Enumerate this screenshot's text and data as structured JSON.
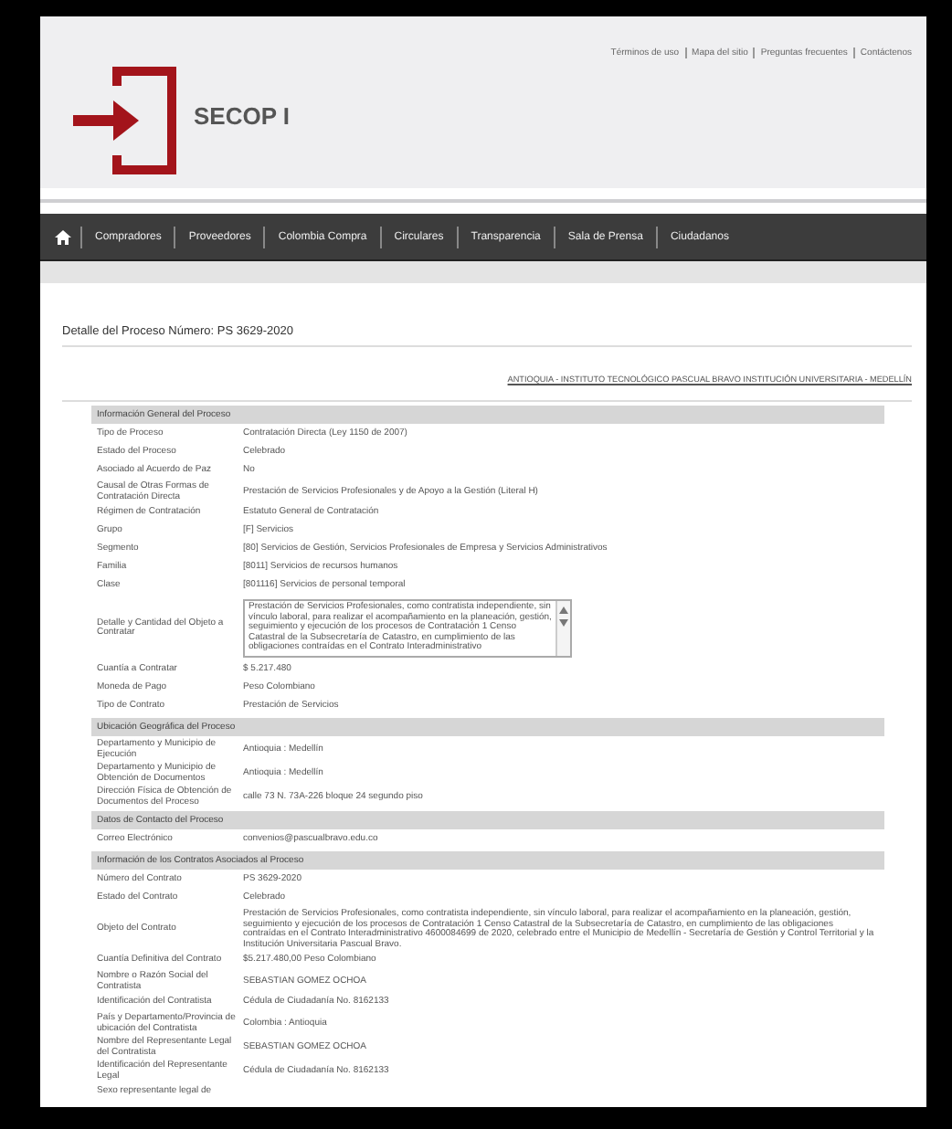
{
  "top_links": [
    "Términos de uso",
    "Mapa del sitio",
    "Preguntas frecuentes",
    "Contáctenos"
  ],
  "logo": {
    "text": "SECOP I"
  },
  "nav": [
    "Compradores",
    "Proveedores",
    "Colombia Compra",
    "Circulares",
    "Transparencia",
    "Sala de Prensa",
    "Ciudadanos"
  ],
  "title": "Detalle del Proceso Número: PS 3629-2020",
  "entity_link": "ANTIOQUIA - INSTITUTO TECNOLÓGICO PASCUAL BRAVO INSTITUCIÓN UNIVERSITARIA - MEDELLÍN",
  "sections": [
    {
      "title": "Información General del Proceso",
      "rows": [
        {
          "kind": "text",
          "label": "Tipo de Proceso",
          "value": "Contratación Directa (Ley 1150 de 2007)"
        },
        {
          "kind": "text",
          "label": "Estado del Proceso",
          "value": "Celebrado"
        },
        {
          "kind": "text",
          "label": "Asociado al Acuerdo de Paz",
          "value": "No"
        },
        {
          "kind": "text",
          "label": "Causal de Otras Formas de Contratación Directa",
          "value": "Prestación de Servicios Profesionales y de Apoyo a la Gestión (Literal H)"
        },
        {
          "kind": "text",
          "label": "Régimen de Contratación",
          "value": "Estatuto General de Contratación"
        },
        {
          "kind": "text",
          "label": "Grupo",
          "value": "[F] Servicios"
        },
        {
          "kind": "text",
          "label": "Segmento",
          "value": "[80] Servicios de Gestión, Servicios Profesionales de Empresa y Servicios Administrativos"
        },
        {
          "kind": "text",
          "label": "Familia",
          "value": "[8011] Servicios de recursos humanos"
        },
        {
          "kind": "text",
          "label": "Clase",
          "value": "[801116] Servicios de personal temporal"
        },
        {
          "kind": "textarea",
          "label": "Detalle y Cantidad del Objeto a Contratar",
          "value": "Prestación de Servicios Profesionales, como contratista independiente, sin vínculo laboral, para realizar el acompañamiento en la planeación, gestión, seguimiento y ejecución de los procesos de Contratación 1 Censo Catastral de la Subsecretaría de Catastro, en cumplimiento de las obligaciones contraídas en el Contrato Interadministrativo"
        },
        {
          "kind": "text",
          "label": "Cuantía a Contratar",
          "value": "$ 5.217.480"
        },
        {
          "kind": "text",
          "label": "Moneda de Pago",
          "value": "Peso Colombiano"
        },
        {
          "kind": "text",
          "label": "Tipo de Contrato",
          "value": "Prestación de Servicios"
        }
      ]
    },
    {
      "title": "Ubicación Geográfica del Proceso",
      "rows": [
        {
          "kind": "text",
          "label": "Departamento y Municipio de Ejecución",
          "value": "Antioquia : Medellín"
        },
        {
          "kind": "text",
          "label": "Departamento y Municipio de Obtención de Documentos",
          "value": "Antioquia : Medellín"
        },
        {
          "kind": "text",
          "label": "Dirección Física de Obtención de Documentos del Proceso",
          "value": "calle 73 N. 73A-226 bloque 24 segundo piso"
        }
      ]
    },
    {
      "title": "Datos de Contacto del Proceso",
      "rows": [
        {
          "kind": "text",
          "label": "Correo Electrónico",
          "value": "convenios@pascualbravo.edu.co"
        }
      ]
    },
    {
      "title": "Información de los Contratos Asociados al Proceso",
      "rows": [
        {
          "kind": "text",
          "label": "Número del Contrato",
          "value": "PS 3629-2020"
        },
        {
          "kind": "text",
          "label": "Estado del Contrato",
          "value": "Celebrado"
        },
        {
          "kind": "text",
          "label": "Objeto del Contrato",
          "value": "Prestación de Servicios Profesionales, como contratista independiente, sin vínculo laboral, para realizar el acompañamiento en la planeación, gestión, seguimiento y ejecución de los procesos de Contratación 1 Censo Catastral de la Subsecretaría de Catastro, en cumplimiento de las obligaciones contraídas en el Contrato Interadministrativo 4600084699 de 2020, celebrado entre el Municipio de Medellín - Secretaría de Gestión y Control Territorial y la Institución Universitaria Pascual Bravo."
        },
        {
          "kind": "text",
          "label": "Cuantía Definitiva del Contrato",
          "value": "$5.217.480,00 Peso Colombiano"
        },
        {
          "kind": "text",
          "label": "Nombre o Razón Social del Contratista",
          "value": "SEBASTIAN GOMEZ OCHOA"
        },
        {
          "kind": "text",
          "label": "Identificación del Contratista",
          "value": "Cédula de Ciudadanía No. 8162133"
        },
        {
          "kind": "text",
          "label": "País y Departamento/Provincia de ubicación del Contratista",
          "value": "Colombia : Antioquia"
        },
        {
          "kind": "text",
          "label": "Nombre del Representante Legal del Contratista",
          "value": "SEBASTIAN GOMEZ OCHOA"
        },
        {
          "kind": "text",
          "label": "Identificación del Representante Legal",
          "value": "Cédula de Ciudadanía No. 8162133"
        },
        {
          "kind": "text",
          "label": "Sexo representante legal de"
        }
      ]
    }
  ]
}
